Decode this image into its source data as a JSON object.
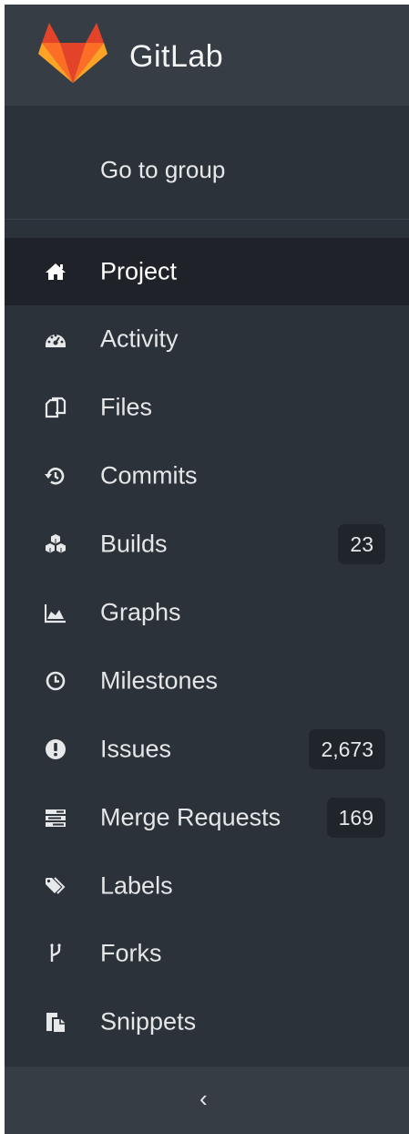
{
  "brand": {
    "title": "GitLab",
    "logo": "gitlab-tanuki-logo"
  },
  "group_link": {
    "label": "Go to group"
  },
  "nav": {
    "items": [
      {
        "label": "Project",
        "icon": "home-icon",
        "active": true
      },
      {
        "label": "Activity",
        "icon": "dashboard-icon"
      },
      {
        "label": "Files",
        "icon": "files-icon"
      },
      {
        "label": "Commits",
        "icon": "history-icon"
      },
      {
        "label": "Builds",
        "icon": "cubes-icon",
        "badge": "23"
      },
      {
        "label": "Graphs",
        "icon": "area-chart-icon"
      },
      {
        "label": "Milestones",
        "icon": "clock-icon"
      },
      {
        "label": "Issues",
        "icon": "exclamation-circle-icon",
        "badge": "2,673"
      },
      {
        "label": "Merge Requests",
        "icon": "tasks-icon",
        "badge": "169"
      },
      {
        "label": "Labels",
        "icon": "tags-icon"
      },
      {
        "label": "Forks",
        "icon": "code-fork-icon"
      },
      {
        "label": "Snippets",
        "icon": "clipboard-icon"
      }
    ]
  },
  "collapse": {
    "label": "‹"
  },
  "colors": {
    "sidebar_bg": "#2c323a",
    "header_bg": "#363d45",
    "active_bg": "#1f2329",
    "badge_bg": "#20252b",
    "text": "#e6e8ea"
  }
}
